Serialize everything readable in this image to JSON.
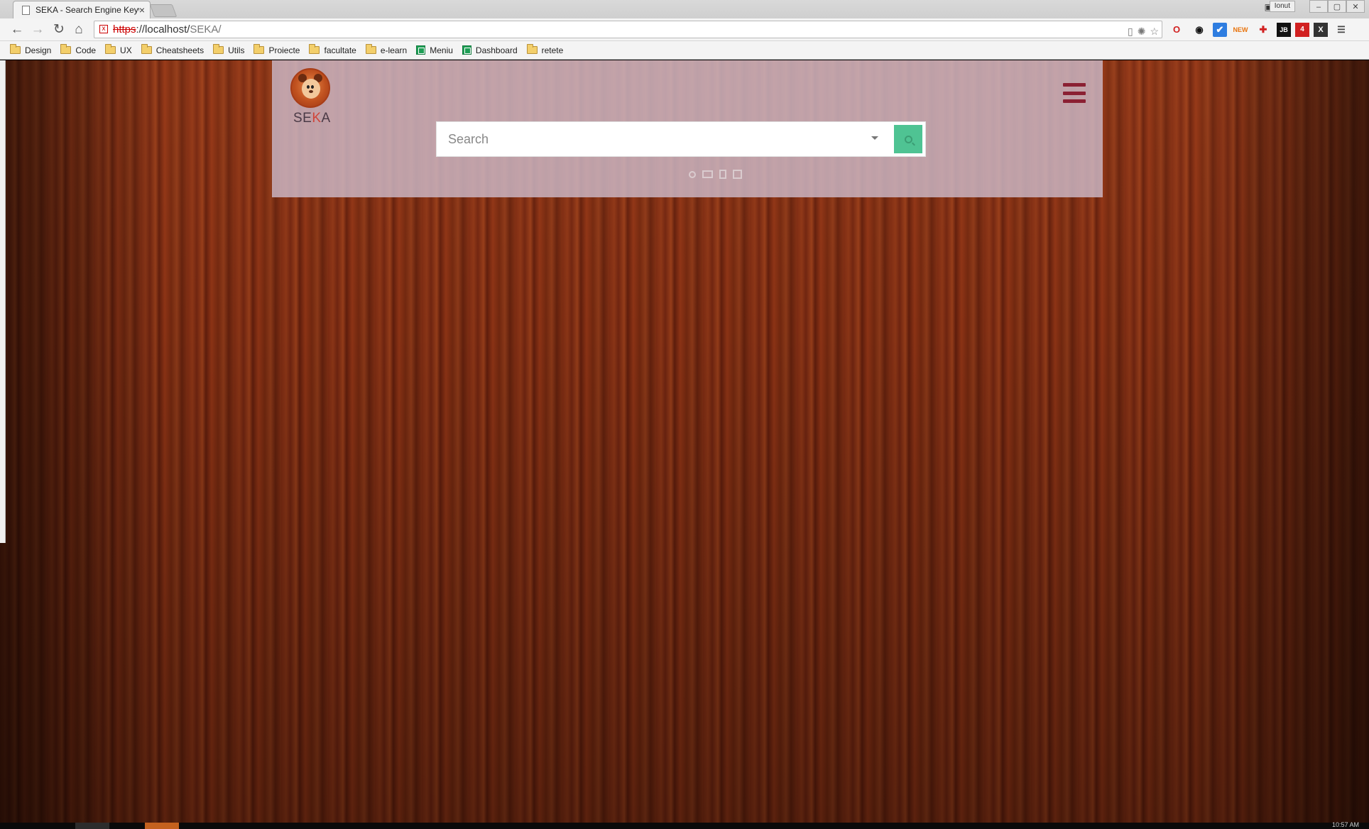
{
  "browser": {
    "tab_title": "SEKA - Search Engine Keyw",
    "tab_close": "×",
    "user_name": "Ionut",
    "window_controls": [
      "–",
      "▢",
      "✕"
    ],
    "url_scheme": "https",
    "url_host": "://localhost/",
    "url_path": "SEKA/",
    "nav": {
      "back": "←",
      "forward": "→",
      "reload": "↻",
      "home": "⌂"
    },
    "extensions": [
      "opera-icon",
      "eye-icon",
      "check-icon",
      "new-icon",
      "puzzle-icon",
      "jb-icon",
      "todoist-icon",
      "x-icon",
      "menu-icon"
    ],
    "ext_labels": [
      "O",
      "◉",
      "✔",
      "NEW",
      "✚",
      "JB",
      "4",
      "X",
      "☰"
    ]
  },
  "bookmarks": [
    {
      "label": "Design",
      "type": "folder"
    },
    {
      "label": "Code",
      "type": "folder"
    },
    {
      "label": "UX",
      "type": "folder"
    },
    {
      "label": "Cheatsheets",
      "type": "folder"
    },
    {
      "label": "Utils",
      "type": "folder"
    },
    {
      "label": "Proiecte",
      "type": "folder"
    },
    {
      "label": "facultate",
      "type": "folder"
    },
    {
      "label": "e-learn",
      "type": "folder"
    },
    {
      "label": "Meniu",
      "type": "sheet"
    },
    {
      "label": "Dashboard",
      "type": "sheet"
    },
    {
      "label": "retete",
      "type": "folder"
    }
  ],
  "page": {
    "brand_prefix": "SE",
    "brand_accent": "K",
    "brand_suffix": "A",
    "search": {
      "placeholder": "Search"
    },
    "search_types": [
      "search-web-icon",
      "search-images-icon",
      "search-documents-icon",
      "search-videos-icon"
    ],
    "colors": {
      "accent_green": "#4fc393",
      "menu_icon": "#8b2033",
      "brand_accent": "#d0453a"
    }
  },
  "taskbar": {
    "clock": "10:57 AM"
  }
}
